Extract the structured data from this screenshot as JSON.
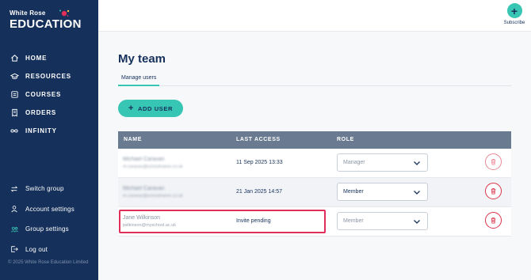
{
  "brand": {
    "line1": "White Rose",
    "line2": "EDUCATION",
    "colors": {
      "navy": "#15305a",
      "teal": "#38c6b4",
      "red": "#d9334a"
    }
  },
  "nav": {
    "primary": [
      {
        "label": "HOME",
        "icon": "home-icon"
      },
      {
        "label": "RESOURCES",
        "icon": "graduation-cap-icon"
      },
      {
        "label": "COURSES",
        "icon": "book-icon"
      },
      {
        "label": "ORDERS",
        "icon": "receipt-icon"
      },
      {
        "label": "INFINITY",
        "icon": "infinity-icon"
      }
    ],
    "secondary": [
      {
        "label": "Switch group",
        "icon": "switch-icon"
      },
      {
        "label": "Account settings",
        "icon": "user-icon"
      },
      {
        "label": "Group settings",
        "icon": "users-icon"
      },
      {
        "label": "Log out",
        "icon": "logout-icon"
      }
    ],
    "copyright": "© 2025 White Rose Education Limited"
  },
  "topbar": {
    "subscribe_label": "Subscribe"
  },
  "page": {
    "title": "My team",
    "tab": "Manage users",
    "add_user_label": "ADD USER"
  },
  "table": {
    "headers": {
      "name": "NAME",
      "last_access": "LAST ACCESS",
      "role": "ROLE"
    },
    "rows": [
      {
        "name": "Michael Caravan",
        "email": "m.caravan@schoolname.co.uk",
        "last_access": "11 Sep 2025 13:33",
        "role": "Manager",
        "blurred": true
      },
      {
        "name": "Michael Caravan",
        "email": "m.caravan@schoolname.co.uk",
        "last_access": "21 Jan 2025 14:57",
        "role": "Member",
        "blurred": true
      },
      {
        "name": "Jane Wilkinson",
        "email": "jwilkinson@myschool.ac.uk",
        "last_access": "Invite pending",
        "role": "Member",
        "blurred": false
      }
    ]
  }
}
